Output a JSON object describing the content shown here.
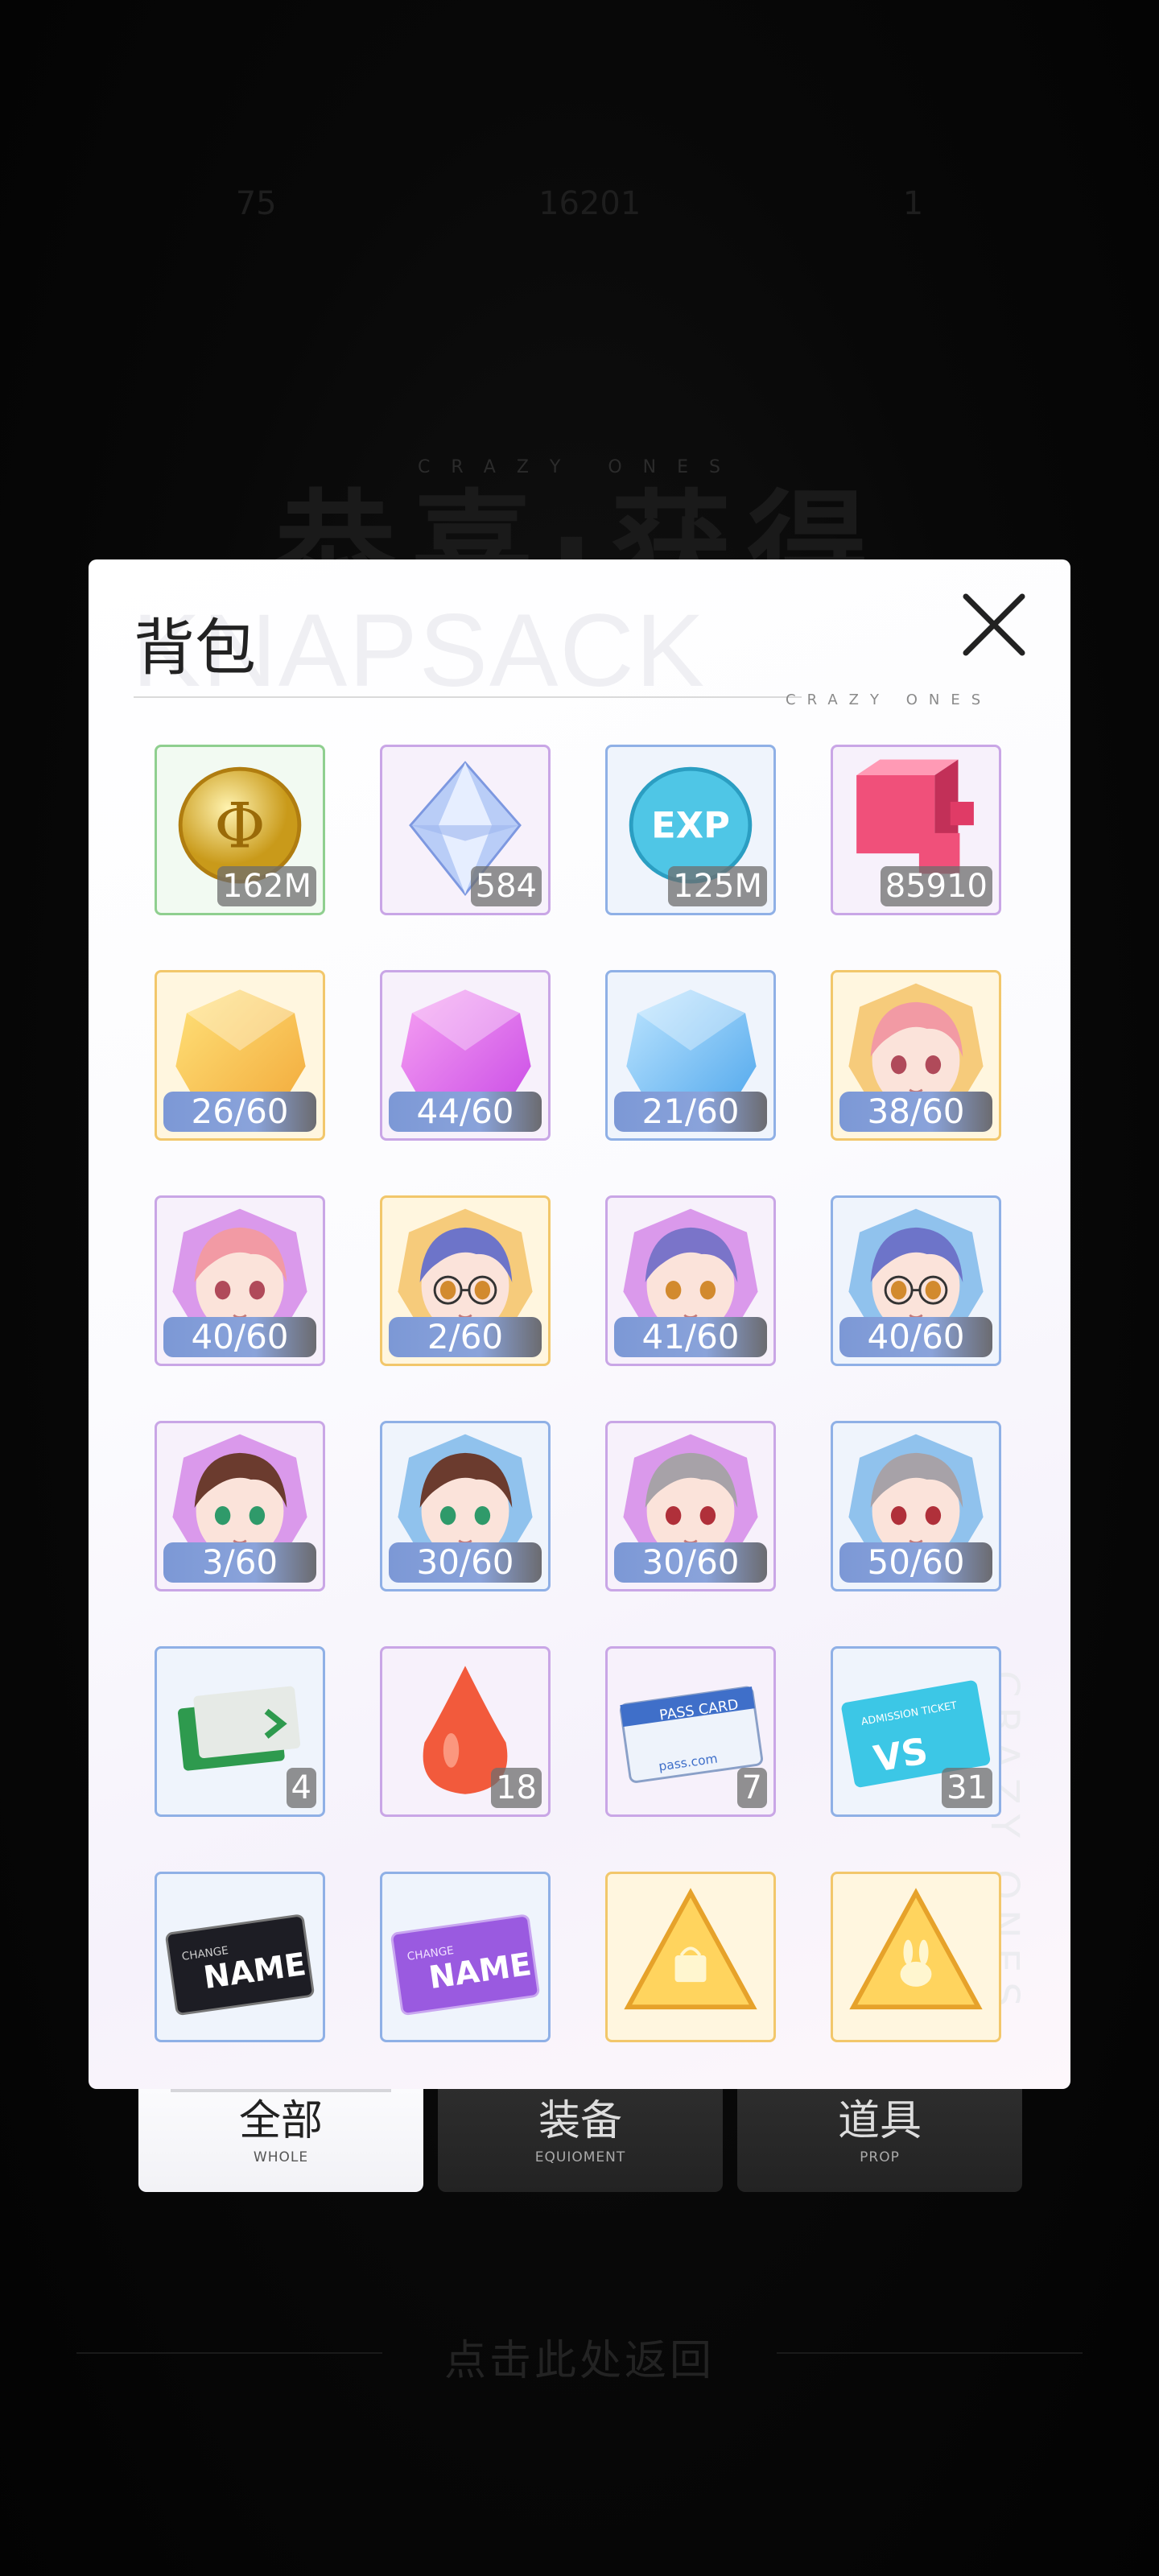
{
  "background": {
    "title": "恭喜·获得",
    "subtitle": "CRAZY ONES",
    "top_stats": [
      "75",
      "16201",
      "1"
    ],
    "return_hint": "点击此处返回"
  },
  "panel": {
    "title": "背包",
    "watermark": "KNAPSACK",
    "tag": "CRAZY ONES",
    "vertical_tag": "CRAZY ONES"
  },
  "items": [
    {
      "name": "gold-coin",
      "qty": "162M",
      "kind": "qty",
      "border": "#8fcf8f"
    },
    {
      "name": "diamond-crystal",
      "qty": "584",
      "kind": "qty",
      "border": "#c9a6e6"
    },
    {
      "name": "exp-coin",
      "qty": "125M",
      "kind": "qty",
      "border": "#8fb0e6"
    },
    {
      "name": "red-cubes",
      "qty": "85910",
      "kind": "qty",
      "border": "#c9a6e6"
    },
    {
      "name": "gold-fragment",
      "qty": "26/60",
      "kind": "frag",
      "border": "#f2c76b"
    },
    {
      "name": "purple-fragment",
      "qty": "44/60",
      "kind": "frag",
      "border": "#c9a6e6"
    },
    {
      "name": "blue-fragment",
      "qty": "21/60",
      "kind": "frag",
      "border": "#8fb0e6"
    },
    {
      "name": "pink-hair-gold-fragment",
      "qty": "38/60",
      "kind": "frag",
      "border": "#f2c76b"
    },
    {
      "name": "pink-hair-purple-fragment",
      "qty": "40/60",
      "kind": "frag",
      "border": "#c9a6e6"
    },
    {
      "name": "glasses-gold-fragment",
      "qty": "2/60",
      "kind": "frag",
      "border": "#f2c76b"
    },
    {
      "name": "purple-hair-purple-fragment",
      "qty": "41/60",
      "kind": "frag",
      "border": "#c9a6e6"
    },
    {
      "name": "glasses-blue-fragment",
      "qty": "40/60",
      "kind": "frag",
      "border": "#8fb0e6"
    },
    {
      "name": "brown-hair-purple-fragment",
      "qty": "3/60",
      "kind": "frag",
      "border": "#c9a6e6"
    },
    {
      "name": "brown-hair-blue-fragment",
      "qty": "30/60",
      "kind": "frag",
      "border": "#8fb0e6"
    },
    {
      "name": "silver-hair-purple-fragment",
      "qty": "30/60",
      "kind": "frag",
      "border": "#c9a6e6"
    },
    {
      "name": "silver-hair-blue-fragment",
      "qty": "50/60",
      "kind": "frag",
      "border": "#8fb0e6"
    },
    {
      "name": "green-ticket",
      "qty": "4",
      "kind": "qty",
      "border": "#8fb0e6"
    },
    {
      "name": "red-drop",
      "qty": "18",
      "kind": "qty",
      "border": "#c9a6e6"
    },
    {
      "name": "pass-card",
      "qty": "7",
      "kind": "qty",
      "border": "#c9a6e6"
    },
    {
      "name": "vs-ticket",
      "qty": "31",
      "kind": "qty",
      "border": "#8fb0e6"
    },
    {
      "name": "black-name-card",
      "qty": "",
      "kind": "none",
      "border": "#8fb0e6"
    },
    {
      "name": "purple-name-card",
      "qty": "",
      "kind": "none",
      "border": "#8fb0e6"
    },
    {
      "name": "gold-bag-box",
      "qty": "",
      "kind": "none",
      "border": "#f2c76b"
    },
    {
      "name": "gold-bunny-box",
      "qty": "",
      "kind": "none",
      "border": "#f2c76b"
    }
  ],
  "item_texts": {
    "pass_card_label": "PASS CARD",
    "pass_card_sub": "pass.com",
    "vs_label": "VS",
    "vs_top": "ADMISSION TICKET",
    "name_card_label": "NAME",
    "name_card_change": "CHANGE",
    "exp_label": "EXP"
  },
  "tabs": [
    {
      "cn": "全部",
      "en": "WHOLE",
      "active": true
    },
    {
      "cn": "装备",
      "en": "EQUIOMENT",
      "active": false
    },
    {
      "cn": "道具",
      "en": "PROP",
      "active": false
    }
  ]
}
